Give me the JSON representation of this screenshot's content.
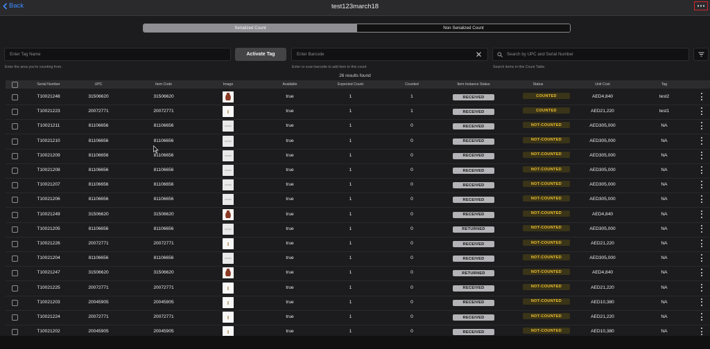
{
  "header": {
    "back_label": "Back",
    "title": "test123march18"
  },
  "tabs": [
    {
      "label": "Serialized Count",
      "selected": true
    },
    {
      "label": "Non Serialized Count",
      "selected": false
    }
  ],
  "controls": {
    "tag_placeholder": "Enter Tag Name",
    "tag_hint": "Enter the area you're counting from.",
    "activate_label": "Activate Tag",
    "barcode_placeholder": "Enter Barcode",
    "barcode_hint": "Enter or scan barcode to add item to this count",
    "search_placeholder": "Search by UPC and Serial Number",
    "search_hint": "Search items in this Count Table."
  },
  "results_text": "26 results found",
  "columns": [
    "Serial Number",
    "UPC",
    "Item Code",
    "Image",
    "Available",
    "Expected Count",
    "Counted",
    "Item Instance Status",
    "Status",
    "Unit Cost",
    "Tag"
  ],
  "colors": {
    "accent": "#3d8bff",
    "status_text": "#f2c230",
    "instance_badge": "#b3b3b8",
    "highlight_box": "#d6252a"
  },
  "rows": [
    {
      "serial": "T10021248",
      "upc": "31506620",
      "item_code": "31506620",
      "image": "vase",
      "available": "true",
      "expected": "1",
      "counted": "1",
      "instance_status": "RECEIVED",
      "status": "COUNTED",
      "unit_cost": "AED4,840",
      "tag": "test2"
    },
    {
      "serial": "T10021223",
      "upc": "20072771",
      "item_code": "20072771",
      "image": "small",
      "available": "true",
      "expected": "1",
      "counted": "1",
      "instance_status": "RECEIVED",
      "status": "COUNTED",
      "unit_cost": "AED21,220",
      "tag": "test1"
    },
    {
      "serial": "T10021211",
      "upc": "81106656",
      "item_code": "81106656",
      "image": "flat",
      "available": "true",
      "expected": "1",
      "counted": "0",
      "instance_status": "RECEIVED",
      "status": "NOT-COUNTED",
      "unit_cost": "AED305,000",
      "tag": "NA"
    },
    {
      "serial": "T10021210",
      "upc": "81106656",
      "item_code": "81106656",
      "image": "flat",
      "available": "true",
      "expected": "1",
      "counted": "0",
      "instance_status": "RECEIVED",
      "status": "NOT-COUNTED",
      "unit_cost": "AED305,000",
      "tag": "NA"
    },
    {
      "serial": "T10021209",
      "upc": "81106656",
      "item_code": "81106656",
      "image": "flat",
      "available": "true",
      "expected": "1",
      "counted": "0",
      "instance_status": "RECEIVED",
      "status": "NOT-COUNTED",
      "unit_cost": "AED305,000",
      "tag": "NA"
    },
    {
      "serial": "T10021208",
      "upc": "81106656",
      "item_code": "81106656",
      "image": "flat",
      "available": "true",
      "expected": "1",
      "counted": "0",
      "instance_status": "RECEIVED",
      "status": "NOT-COUNTED",
      "unit_cost": "AED305,000",
      "tag": "NA"
    },
    {
      "serial": "T10021207",
      "upc": "81106656",
      "item_code": "81106656",
      "image": "flat",
      "available": "true",
      "expected": "1",
      "counted": "0",
      "instance_status": "RECEIVED",
      "status": "NOT-COUNTED",
      "unit_cost": "AED305,000",
      "tag": "NA"
    },
    {
      "serial": "T10021206",
      "upc": "81106656",
      "item_code": "81106656",
      "image": "flat",
      "available": "true",
      "expected": "1",
      "counted": "0",
      "instance_status": "RECEIVED",
      "status": "NOT-COUNTED",
      "unit_cost": "AED305,000",
      "tag": "NA"
    },
    {
      "serial": "T10021249",
      "upc": "31506620",
      "item_code": "31506620",
      "image": "vase",
      "available": "true",
      "expected": "1",
      "counted": "0",
      "instance_status": "RECEIVED",
      "status": "NOT-COUNTED",
      "unit_cost": "AED4,840",
      "tag": "NA"
    },
    {
      "serial": "T10021205",
      "upc": "81106656",
      "item_code": "81106656",
      "image": "flat",
      "available": "true",
      "expected": "1",
      "counted": "0",
      "instance_status": "RETURNED",
      "status": "NOT-COUNTED",
      "unit_cost": "AED305,000",
      "tag": "NA"
    },
    {
      "serial": "T10021226",
      "upc": "20072771",
      "item_code": "20072771",
      "image": "small",
      "available": "true",
      "expected": "1",
      "counted": "0",
      "instance_status": "RECEIVED",
      "status": "NOT-COUNTED",
      "unit_cost": "AED21,220",
      "tag": "NA"
    },
    {
      "serial": "T10021204",
      "upc": "81106656",
      "item_code": "81106656",
      "image": "flat",
      "available": "true",
      "expected": "1",
      "counted": "0",
      "instance_status": "RECEIVED",
      "status": "NOT-COUNTED",
      "unit_cost": "AED305,000",
      "tag": "NA"
    },
    {
      "serial": "T10021247",
      "upc": "31506620",
      "item_code": "31506620",
      "image": "vase",
      "available": "true",
      "expected": "1",
      "counted": "0",
      "instance_status": "RETURNED",
      "status": "NOT-COUNTED",
      "unit_cost": "AED4,840",
      "tag": "NA"
    },
    {
      "serial": "T10021225",
      "upc": "20072771",
      "item_code": "20072771",
      "image": "small",
      "available": "true",
      "expected": "1",
      "counted": "0",
      "instance_status": "RECEIVED",
      "status": "NOT-COUNTED",
      "unit_cost": "AED21,220",
      "tag": "NA"
    },
    {
      "serial": "T10021203",
      "upc": "20045905",
      "item_code": "20045905",
      "image": "small",
      "available": "true",
      "expected": "1",
      "counted": "0",
      "instance_status": "RECEIVED",
      "status": "NOT-COUNTED",
      "unit_cost": "AED10,380",
      "tag": "NA"
    },
    {
      "serial": "T10021224",
      "upc": "20072771",
      "item_code": "20072771",
      "image": "small",
      "available": "true",
      "expected": "1",
      "counted": "0",
      "instance_status": "RECEIVED",
      "status": "NOT-COUNTED",
      "unit_cost": "AED21,220",
      "tag": "NA"
    },
    {
      "serial": "T10021202",
      "upc": "20045905",
      "item_code": "20045905",
      "image": "small",
      "available": "true",
      "expected": "1",
      "counted": "0",
      "instance_status": "RECEIVED",
      "status": "NOT-COUNTED",
      "unit_cost": "AED10,380",
      "tag": "NA"
    }
  ]
}
